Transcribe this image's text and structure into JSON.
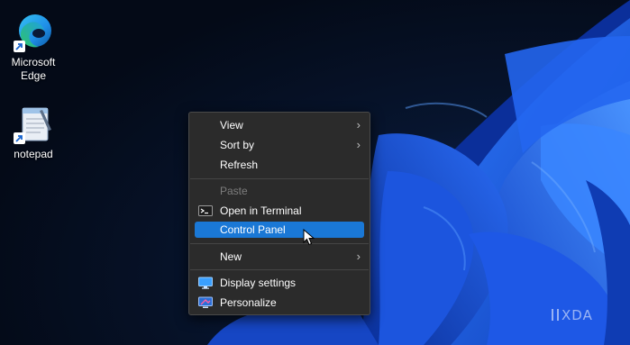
{
  "desktop_icons": [
    {
      "label_line1": "Microsoft",
      "label_line2": "Edge",
      "icon": "edge-icon"
    },
    {
      "label": "notepad",
      "icon": "notepad-icon"
    }
  ],
  "context_menu": {
    "items": [
      {
        "label": "View",
        "submenu": true,
        "enabled": true
      },
      {
        "label": "Sort by",
        "submenu": true,
        "enabled": true
      },
      {
        "label": "Refresh",
        "enabled": true
      },
      {
        "label": "Paste",
        "enabled": false
      },
      {
        "label": "Open in Terminal",
        "icon": "terminal-icon",
        "enabled": true
      },
      {
        "label": "Control Panel",
        "enabled": true,
        "highlighted": true
      },
      {
        "label": "New",
        "submenu": true,
        "enabled": true
      },
      {
        "label": "Display settings",
        "icon": "display-icon",
        "enabled": true
      },
      {
        "label": "Personalize",
        "icon": "personalize-icon",
        "enabled": true
      }
    ],
    "submenu_glyph": "›"
  },
  "watermark": {
    "text": "XDA"
  },
  "colors": {
    "highlight": "#1a78d6",
    "menu_bg": "#2b2b2b",
    "wallpaper_blue": "#1f5fe8"
  }
}
